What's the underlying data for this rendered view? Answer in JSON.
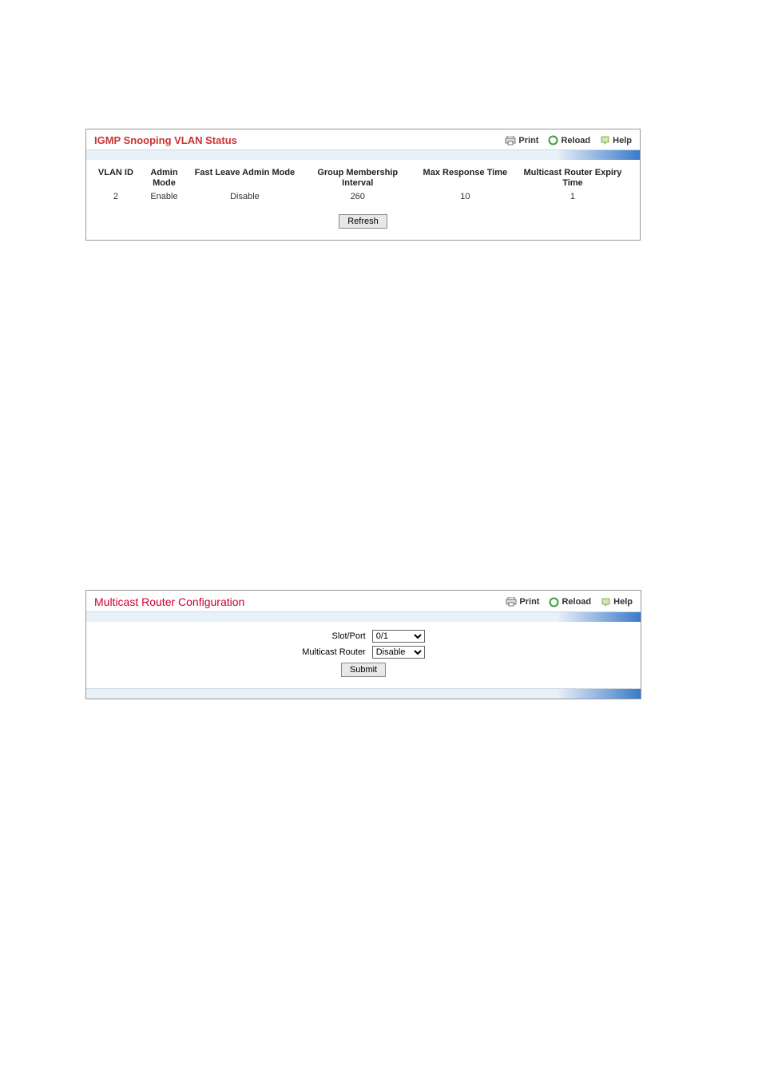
{
  "panel1": {
    "title": "IGMP Snooping VLAN Status",
    "header_links": {
      "print": "Print",
      "reload": "Reload",
      "help": "Help"
    },
    "columns": {
      "vlan_id": "VLAN ID",
      "admin_mode": "Admin Mode",
      "fast_leave": "Fast Leave Admin Mode",
      "group_membership": "Group Membership Interval",
      "max_response": "Max Response Time",
      "mcast_router": "Multicast Router Expiry Time"
    },
    "row": {
      "vlan_id": "2",
      "admin_mode": "Enable",
      "fast_leave": "Disable",
      "group_membership": "260",
      "max_response": "10",
      "mcast_router": "1"
    },
    "refresh_label": "Refresh"
  },
  "panel2": {
    "title": "Multicast Router Configuration",
    "header_links": {
      "print": "Print",
      "reload": "Reload",
      "help": "Help"
    },
    "fields": {
      "slot_port_label": "Slot/Port",
      "slot_port_value": "0/1",
      "mcast_router_label": "Multicast Router",
      "mcast_router_value": "Disable"
    },
    "submit_label": "Submit"
  }
}
